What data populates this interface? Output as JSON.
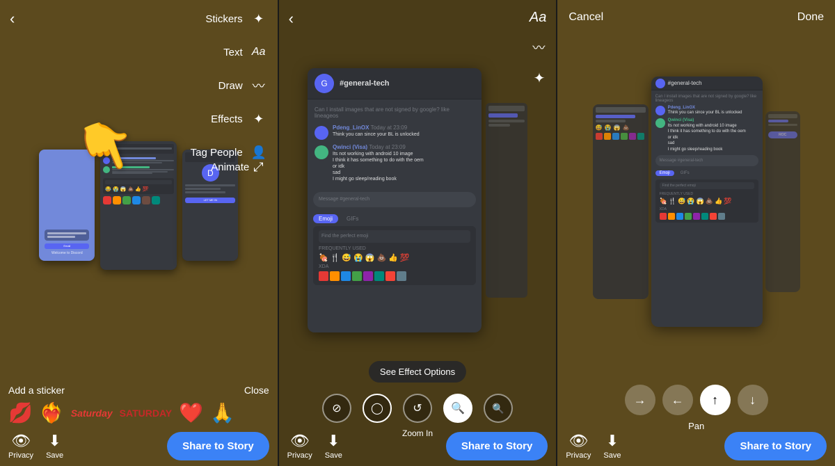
{
  "panels": [
    {
      "id": "panel-1",
      "toolbar": {
        "items": [
          {
            "label": "Stickers",
            "icon": "✦"
          },
          {
            "label": "Text",
            "icon": "Aa"
          },
          {
            "label": "Draw",
            "icon": "✏"
          },
          {
            "label": "Effects",
            "icon": "✦"
          },
          {
            "label": "Tag People",
            "icon": "👤"
          }
        ]
      },
      "animate_label": "Animate",
      "sticker_header": "Add a sticker",
      "close_label": "Close",
      "stickers": [
        "💋",
        "❤️",
        "💗",
        "🙏"
      ],
      "bottom": {
        "privacy_label": "Privacy",
        "save_label": "Save",
        "share_label": "Share to Story"
      }
    },
    {
      "id": "panel-2",
      "effect_popup": "See Effect Options",
      "zoom_label": "Zoom In",
      "bottom": {
        "privacy_label": "Privacy",
        "save_label": "Save",
        "share_label": "Share to Story"
      }
    },
    {
      "id": "panel-3",
      "header": {
        "cancel_label": "Cancel",
        "done_label": "Done"
      },
      "pan_label": "Pan",
      "bottom": {
        "privacy_label": "Privacy",
        "save_label": "Save",
        "share_label": "Share to Story"
      }
    }
  ],
  "messages": [
    {
      "author": "Pdeng_LinOX",
      "avatar_color": "#5865f2",
      "text": "Think you can since your BL is unlocked"
    },
    {
      "author": "Qwinci (Visa)",
      "avatar_color": "#43b581",
      "text": "Its not working with android 10 image\nI think it has something to do with the oem\nor idk\nsad\nI might go sleep/reading book"
    }
  ],
  "emojis": [
    "🍖",
    "🍴",
    "😅",
    "😭",
    "😱",
    "💩",
    "👍",
    "💯"
  ],
  "xda_emojis": [
    "📱",
    "✖️",
    "📺",
    "🎮",
    "🎯",
    "🎪",
    "📻",
    "📡"
  ]
}
